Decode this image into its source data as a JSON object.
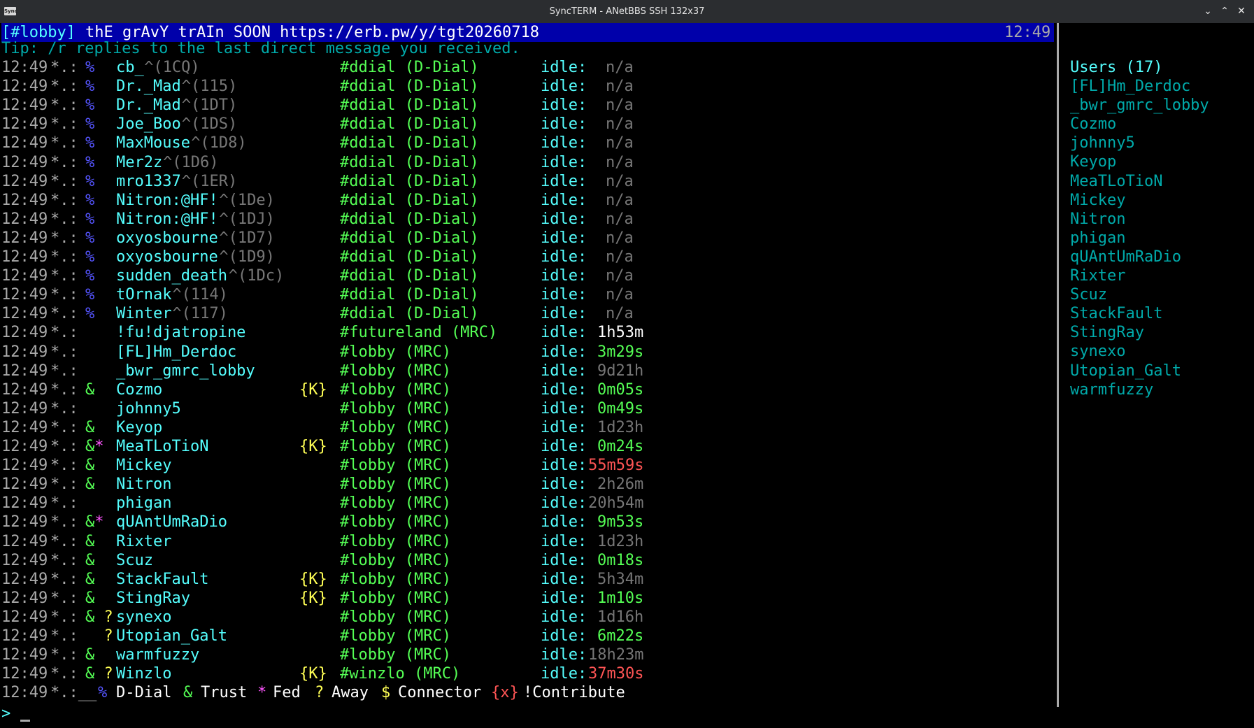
{
  "window": {
    "app_icon_label": "Sync",
    "title": "SyncTERM - ANetBBS SSH 132x37",
    "minimize_glyph": "⌄",
    "maximize_glyph": "⌃",
    "close_glyph": "✕"
  },
  "status": {
    "channel": "[#lobby]",
    "topic": "thE grAvY trAIn SOON https://erb.pw/y/tgt20260718",
    "time": "12:49"
  },
  "tip": "Tip: /r replies to the last direct message you received.",
  "colors": {
    "ts": "#aaaaaa",
    "cyan": "#55ffff",
    "green": "#55ff55",
    "pink": "#ff55ff",
    "yellow": "#ffff55",
    "red": "#ff5555",
    "white": "#ffffff",
    "blue": "#5555ff",
    "dim": "#777777",
    "grey": "#aaaaaa",
    "statusbar": "#0000aa"
  },
  "rows": [
    {
      "ts": "12:49",
      "sep": "*.:",
      "flags": "%",
      "nick": "cb_",
      "suffix": "^(1CQ)",
      "k": "",
      "chan": "#ddial (D-Dial)",
      "idle": "idle:",
      "val": "n/a",
      "val_color": "dim"
    },
    {
      "ts": "12:49",
      "sep": "*.:",
      "flags": "%",
      "nick": "Dr._Mad",
      "suffix": "^(115)",
      "k": "",
      "chan": "#ddial (D-Dial)",
      "idle": "idle:",
      "val": "n/a",
      "val_color": "dim"
    },
    {
      "ts": "12:49",
      "sep": "*.:",
      "flags": "%",
      "nick": "Dr._Mad",
      "suffix": "^(1DT)",
      "k": "",
      "chan": "#ddial (D-Dial)",
      "idle": "idle:",
      "val": "n/a",
      "val_color": "dim"
    },
    {
      "ts": "12:49",
      "sep": "*.:",
      "flags": "%",
      "nick": "Joe_Boo",
      "suffix": "^(1DS)",
      "k": "",
      "chan": "#ddial (D-Dial)",
      "idle": "idle:",
      "val": "n/a",
      "val_color": "dim"
    },
    {
      "ts": "12:49",
      "sep": "*.:",
      "flags": "%",
      "nick": "MaxMouse",
      "suffix": "^(1D8)",
      "k": "",
      "chan": "#ddial (D-Dial)",
      "idle": "idle:",
      "val": "n/a",
      "val_color": "dim"
    },
    {
      "ts": "12:49",
      "sep": "*.:",
      "flags": "%",
      "nick": "Mer2z",
      "suffix": "^(1D6)",
      "k": "",
      "chan": "#ddial (D-Dial)",
      "idle": "idle:",
      "val": "n/a",
      "val_color": "dim"
    },
    {
      "ts": "12:49",
      "sep": "*.:",
      "flags": "%",
      "nick": "mro1337",
      "suffix": "^(1ER)",
      "k": "",
      "chan": "#ddial (D-Dial)",
      "idle": "idle:",
      "val": "n/a",
      "val_color": "dim"
    },
    {
      "ts": "12:49",
      "sep": "*.:",
      "flags": "%",
      "nick": "Nitron:@HF!",
      "suffix": "^(1De)",
      "k": "",
      "chan": "#ddial (D-Dial)",
      "idle": "idle:",
      "val": "n/a",
      "val_color": "dim"
    },
    {
      "ts": "12:49",
      "sep": "*.:",
      "flags": "%",
      "nick": "Nitron:@HF!",
      "suffix": "^(1DJ)",
      "k": "",
      "chan": "#ddial (D-Dial)",
      "idle": "idle:",
      "val": "n/a",
      "val_color": "dim"
    },
    {
      "ts": "12:49",
      "sep": "*.:",
      "flags": "%",
      "nick": "oxyosbourne",
      "suffix": "^(1D7)",
      "k": "",
      "chan": "#ddial (D-Dial)",
      "idle": "idle:",
      "val": "n/a",
      "val_color": "dim"
    },
    {
      "ts": "12:49",
      "sep": "*.:",
      "flags": "%",
      "nick": "oxyosbourne",
      "suffix": "^(1D9)",
      "k": "",
      "chan": "#ddial (D-Dial)",
      "idle": "idle:",
      "val": "n/a",
      "val_color": "dim"
    },
    {
      "ts": "12:49",
      "sep": "*.:",
      "flags": "%",
      "nick": "sudden_death",
      "suffix": "^(1Dc)",
      "k": "",
      "chan": "#ddial (D-Dial)",
      "idle": "idle:",
      "val": "n/a",
      "val_color": "dim"
    },
    {
      "ts": "12:49",
      "sep": "*.:",
      "flags": "%",
      "nick": "tOrnak",
      "suffix": "^(114)",
      "k": "",
      "chan": "#ddial (D-Dial)",
      "idle": "idle:",
      "val": "n/a",
      "val_color": "dim"
    },
    {
      "ts": "12:49",
      "sep": "*.:",
      "flags": "%",
      "nick": "Winter",
      "suffix": "^(117)",
      "k": "",
      "chan": "#ddial (D-Dial)",
      "idle": "idle:",
      "val": "n/a",
      "val_color": "dim"
    },
    {
      "ts": "12:49",
      "sep": "*.:",
      "flags": "",
      "nick": "!fu!djatropine",
      "suffix": "",
      "k": "",
      "chan": "#futureland (MRC)",
      "idle": "idle:",
      "val": "1h53m",
      "val_color": "white"
    },
    {
      "ts": "12:49",
      "sep": "*.:",
      "flags": "",
      "nick": "[FL]Hm_Derdoc",
      "suffix": "",
      "k": "",
      "chan": "#lobby (MRC)",
      "idle": "idle:",
      "val": "3m29s",
      "val_color": "green"
    },
    {
      "ts": "12:49",
      "sep": "*.:",
      "flags": "",
      "nick": "_bwr_gmrc_lobby",
      "suffix": "",
      "k": "",
      "chan": "#lobby (MRC)",
      "idle": "idle:",
      "val": "9d21h",
      "val_color": "dim"
    },
    {
      "ts": "12:49",
      "sep": "*.:",
      "flags": "&",
      "nick": "Cozmo",
      "suffix": "",
      "k": "{K}",
      "chan": "#lobby (MRC)",
      "idle": "idle:",
      "val": "0m05s",
      "val_color": "green"
    },
    {
      "ts": "12:49",
      "sep": "*.:",
      "flags": "",
      "nick": "johnny5",
      "suffix": "",
      "k": "",
      "chan": "#lobby (MRC)",
      "idle": "idle:",
      "val": "0m49s",
      "val_color": "green"
    },
    {
      "ts": "12:49",
      "sep": "*.:",
      "flags": "&",
      "nick": "Keyop",
      "suffix": "",
      "k": "",
      "chan": "#lobby (MRC)",
      "idle": "idle:",
      "val": "1d23h",
      "val_color": "dim"
    },
    {
      "ts": "12:49",
      "sep": "*.:",
      "flags": "&*",
      "nick": "MeaTLoTioN",
      "suffix": "",
      "k": "{K}",
      "chan": "#lobby (MRC)",
      "idle": "idle:",
      "val": "0m24s",
      "val_color": "green"
    },
    {
      "ts": "12:49",
      "sep": "*.:",
      "flags": "&",
      "nick": "Mickey",
      "suffix": "",
      "k": "",
      "chan": "#lobby (MRC)",
      "idle": "idle:",
      "val": "55m59s",
      "val_color": "red"
    },
    {
      "ts": "12:49",
      "sep": "*.:",
      "flags": "&",
      "nick": "Nitron",
      "suffix": "",
      "k": "",
      "chan": "#lobby (MRC)",
      "idle": "idle:",
      "val": "2h26m",
      "val_color": "dim"
    },
    {
      "ts": "12:49",
      "sep": "*.:",
      "flags": "",
      "nick": "phigan",
      "suffix": "",
      "k": "",
      "chan": "#lobby (MRC)",
      "idle": "idle:",
      "val": "20h54m",
      "val_color": "dim"
    },
    {
      "ts": "12:49",
      "sep": "*.:",
      "flags": "&*",
      "nick": "qUAntUmRaDio",
      "suffix": "",
      "k": "",
      "chan": "#lobby (MRC)",
      "idle": "idle:",
      "val": "9m53s",
      "val_color": "green"
    },
    {
      "ts": "12:49",
      "sep": "*.:",
      "flags": "&",
      "nick": "Rixter",
      "suffix": "",
      "k": "",
      "chan": "#lobby (MRC)",
      "idle": "idle:",
      "val": "1d23h",
      "val_color": "dim"
    },
    {
      "ts": "12:49",
      "sep": "*.:",
      "flags": "&",
      "nick": "Scuz",
      "suffix": "",
      "k": "",
      "chan": "#lobby (MRC)",
      "idle": "idle:",
      "val": "0m18s",
      "val_color": "green"
    },
    {
      "ts": "12:49",
      "sep": "*.:",
      "flags": "&",
      "nick": "StackFault",
      "suffix": "",
      "k": "{K}",
      "chan": "#lobby (MRC)",
      "idle": "idle:",
      "val": "5h34m",
      "val_color": "dim"
    },
    {
      "ts": "12:49",
      "sep": "*.:",
      "flags": "&",
      "nick": "StingRay",
      "suffix": "",
      "k": "{K}",
      "chan": "#lobby (MRC)",
      "idle": "idle:",
      "val": "1m10s",
      "val_color": "green"
    },
    {
      "ts": "12:49",
      "sep": "*.:",
      "flags": "& ?",
      "nick": "synexo",
      "suffix": "",
      "k": "",
      "chan": "#lobby (MRC)",
      "idle": "idle:",
      "val": "1d16h",
      "val_color": "dim"
    },
    {
      "ts": "12:49",
      "sep": "*.:",
      "flags": "  ?",
      "nick": "Utopian_Galt",
      "suffix": "",
      "k": "",
      "chan": "#lobby (MRC)",
      "idle": "idle:",
      "val": "6m22s",
      "val_color": "green"
    },
    {
      "ts": "12:49",
      "sep": "*.:",
      "flags": "&",
      "nick": "warmfuzzy",
      "suffix": "",
      "k": "",
      "chan": "#lobby (MRC)",
      "idle": "idle:",
      "val": "18h23m",
      "val_color": "dim"
    },
    {
      "ts": "12:49",
      "sep": "*.:",
      "flags": "& ?",
      "nick": "Winzlo",
      "suffix": "",
      "k": "{K}",
      "chan": "#winzlo (MRC)",
      "idle": "idle:",
      "val": "37m30s",
      "val_color": "red"
    }
  ],
  "legend": {
    "ts": "12:49",
    "sep": "*.:__",
    "items": [
      {
        "sym": "%",
        "label": "D-Dial",
        "sym_color": "blue"
      },
      {
        "sym": "&",
        "label": "Trust",
        "sym_color": "green"
      },
      {
        "sym": "*",
        "label": "Fed",
        "sym_color": "pink"
      },
      {
        "sym": "?",
        "label": "Away",
        "sym_color": "yellow"
      },
      {
        "sym": "$",
        "label": "Connector",
        "sym_color": "yellow"
      },
      {
        "sym": "{x}",
        "label": "!Contribute",
        "sym_color": "red"
      }
    ]
  },
  "users": {
    "header": "Users (17)",
    "list": [
      "[FL]Hm_Derdoc",
      "_bwr_gmrc_lobby",
      "Cozmo",
      "johnny5",
      "Keyop",
      "MeaTLoTioN",
      "Mickey",
      "Nitron",
      "phigan",
      "qUAntUmRaDio",
      "Rixter",
      "Scuz",
      "StackFault",
      "StingRay",
      "synexo",
      "Utopian_Galt",
      "warmfuzzy"
    ]
  },
  "prompt": ">"
}
